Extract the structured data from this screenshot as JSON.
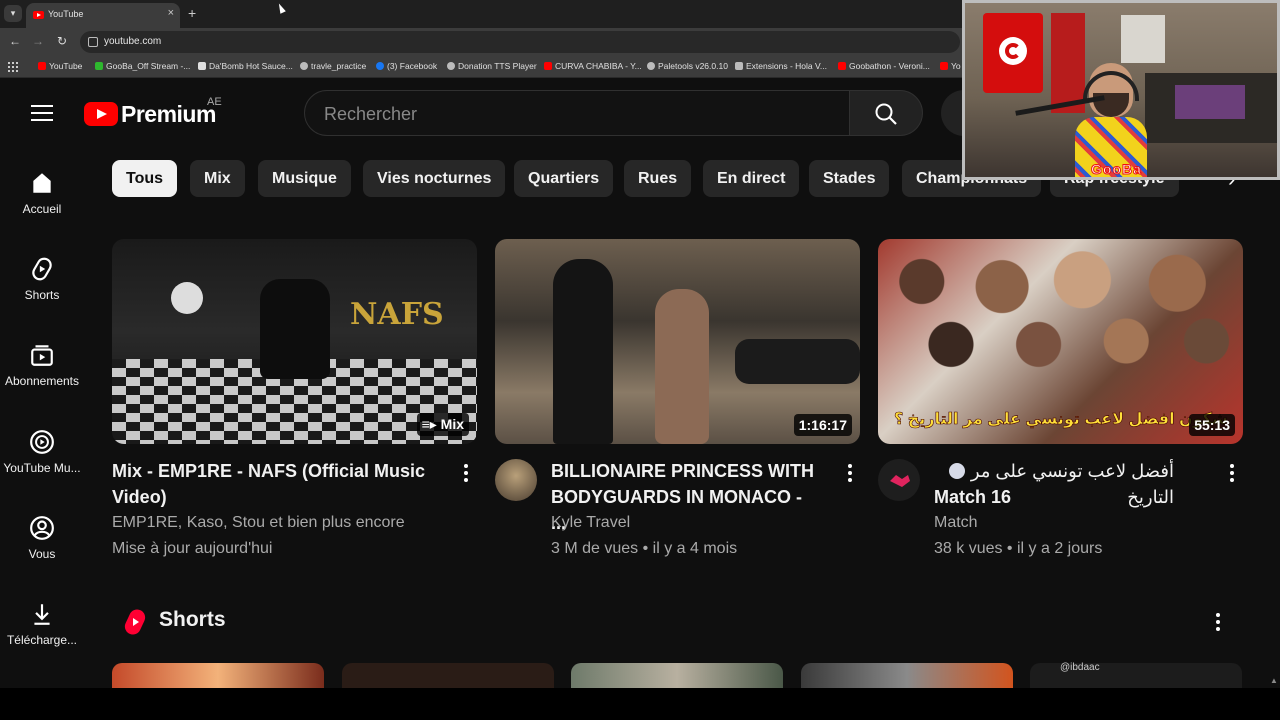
{
  "browser": {
    "tab_title": "YouTube",
    "url": "youtube.com",
    "bookmarks": [
      {
        "label": "YouTube",
        "color": "#ff0000"
      },
      {
        "label": "GooBa_Off Stream -...",
        "color": "#2eb82e"
      },
      {
        "label": "Da'Bomb Hot Sauce...",
        "color": "#e0e0e0"
      },
      {
        "label": "travle_practice",
        "color": "#bbbbbb"
      },
      {
        "label": "(3) Facebook",
        "color": "#1877f2"
      },
      {
        "label": "Donation TTS Player",
        "color": "#bbbbbb"
      },
      {
        "label": "CURVA CHABIBA - Y...",
        "color": "#ff0000"
      },
      {
        "label": "Paletools v26.0.10",
        "color": "#bbbbbb"
      },
      {
        "label": "Extensions - Hola V...",
        "color": "#bbbbbb"
      },
      {
        "label": "Goobathon - Veroni...",
        "color": "#ff0000"
      },
      {
        "label": "Yo",
        "color": "#ff0000"
      }
    ]
  },
  "youtube": {
    "logo_text": "Premium",
    "region": "AE",
    "search_placeholder": "Rechercher",
    "sidebar": [
      {
        "label": "Accueil",
        "icon": "home-icon"
      },
      {
        "label": "Shorts",
        "icon": "shorts-icon"
      },
      {
        "label": "Abonnements",
        "icon": "subscriptions-icon"
      },
      {
        "label": "YouTube Mu...",
        "icon": "youtube-music-icon"
      },
      {
        "label": "Vous",
        "icon": "you-icon"
      },
      {
        "label": "Télécharge...",
        "icon": "download-icon"
      }
    ],
    "chips": [
      "Tous",
      "Mix",
      "Musique",
      "Vies nocturnes",
      "Quartiers",
      "Rues",
      "En direct",
      "Stades",
      "Championnats",
      "Rap freestyle"
    ],
    "active_chip": "Tous",
    "videos": [
      {
        "title": "Mix - EMP1RE - NAFS (Official Music Video)",
        "channel": "EMP1RE, Kaso, Stou et bien plus encore",
        "meta": "Mise à jour aujourd'hui",
        "badge": "Mix",
        "thumb_text": "NAFS",
        "thumb_colors": [
          "#1a1a1a",
          "#e8e8e8",
          "#c9a43a"
        ]
      },
      {
        "title": "BILLIONAIRE PRINCESS WITH BODYGUARDS IN MONACO - ...",
        "channel": "Kyle Travel",
        "meta": "3 M de vues • il y a 4 mois",
        "badge": "1:16:17",
        "thumb_colors": [
          "#3d3a36",
          "#a08f78",
          "#1e1e1e"
        ]
      },
      {
        "title_line1": "أفضل لاعب تونسي على مر التاريخ",
        "title": "Match 16",
        "channel": "Match",
        "meta": "38 k vues • il y a 2 jours",
        "badge": "55:13",
        "thumb_caption": "شكون افضل لاعب تونسي على مر التاريخ ؟",
        "thumb_colors": [
          "#b21f1f",
          "#f1f1f1",
          "#7a4a36"
        ]
      }
    ],
    "shorts_title": "Shorts",
    "shorts_handle": "@ibdaac"
  },
  "webcam": {
    "watermark": "GooBa"
  }
}
